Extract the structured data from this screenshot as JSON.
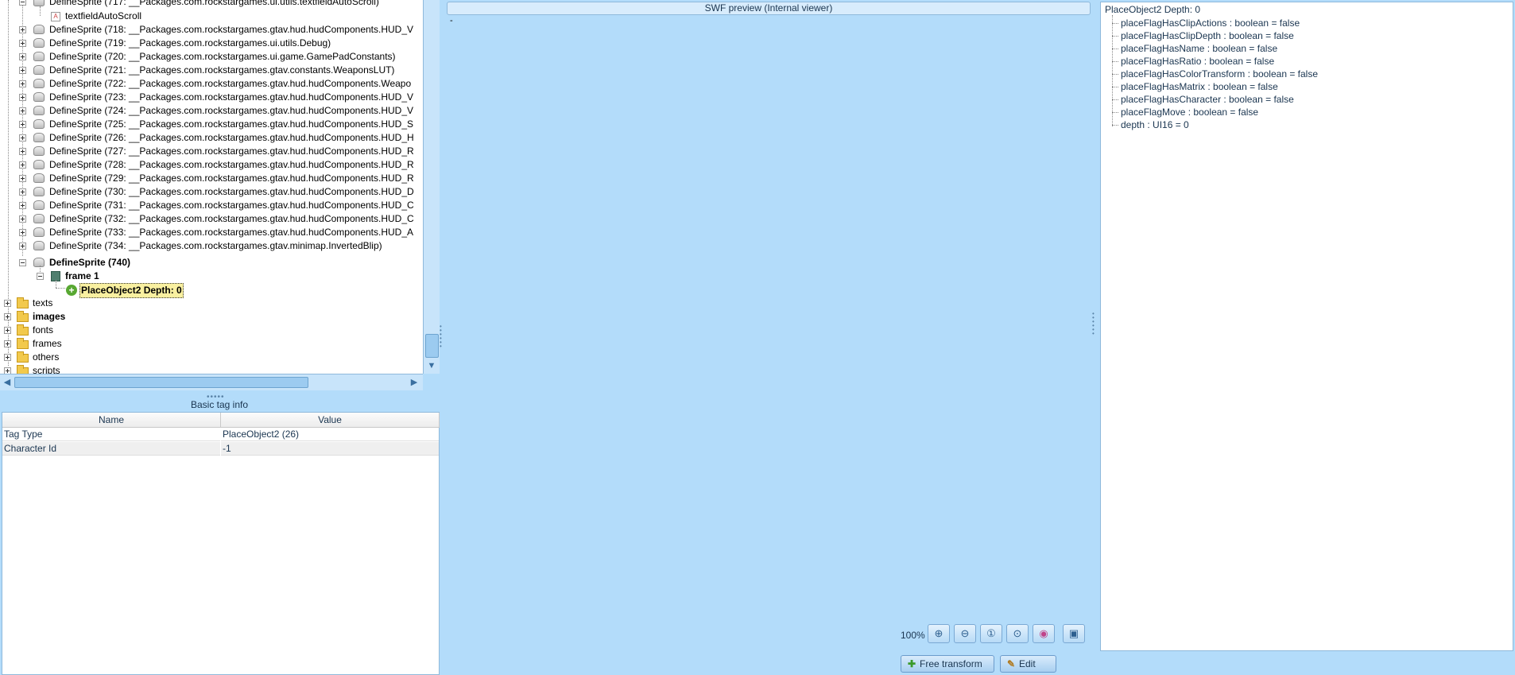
{
  "tree": {
    "top_partial": "DefineSprite (717: __Packages.com.rockstargames.ui.utils.textfieldAutoScroll)",
    "text_child": "textfieldAutoScroll",
    "sprites": [
      "DefineSprite (718: __Packages.com.rockstargames.gtav.hud.hudComponents.HUD_V",
      "DefineSprite (719: __Packages.com.rockstargames.ui.utils.Debug)",
      "DefineSprite (720: __Packages.com.rockstargames.ui.game.GamePadConstants)",
      "DefineSprite (721: __Packages.com.rockstargames.gtav.constants.WeaponsLUT)",
      "DefineSprite (722: __Packages.com.rockstargames.gtav.hud.hudComponents.Weapo",
      "DefineSprite (723: __Packages.com.rockstargames.gtav.hud.hudComponents.HUD_V",
      "DefineSprite (724: __Packages.com.rockstargames.gtav.hud.hudComponents.HUD_V",
      "DefineSprite (725: __Packages.com.rockstargames.gtav.hud.hudComponents.HUD_S",
      "DefineSprite (726: __Packages.com.rockstargames.gtav.hud.hudComponents.HUD_H",
      "DefineSprite (727: __Packages.com.rockstargames.gtav.hud.hudComponents.HUD_R",
      "DefineSprite (728: __Packages.com.rockstargames.gtav.hud.hudComponents.HUD_R",
      "DefineSprite (729: __Packages.com.rockstargames.gtav.hud.hudComponents.HUD_R",
      "DefineSprite (730: __Packages.com.rockstargames.gtav.hud.hudComponents.HUD_D",
      "DefineSprite (731: __Packages.com.rockstargames.gtav.hud.hudComponents.HUD_C",
      "DefineSprite (732: __Packages.com.rockstargames.gtav.hud.hudComponents.HUD_C",
      "DefineSprite (733: __Packages.com.rockstargames.gtav.hud.hudComponents.HUD_A",
      "DefineSprite (734: __Packages.com.rockstargames.gtav.minimap.InvertedBlip)"
    ],
    "open_sprite": "DefineSprite (740)",
    "frame": "frame 1",
    "selected": "PlaceObject2 Depth: 0",
    "folders": [
      "texts",
      "images",
      "fonts",
      "frames",
      "others",
      "scripts"
    ]
  },
  "tag_info": {
    "title": "Basic tag info",
    "columns": [
      "Name",
      "Value"
    ],
    "rows": [
      {
        "name": "Tag Type",
        "value": "PlaceObject2 (26)"
      },
      {
        "name": "Character Id",
        "value": "-1"
      }
    ]
  },
  "preview": {
    "header": "SWF preview (Internal viewer)",
    "placeholder": "-",
    "zoom": "100%",
    "tools": [
      "zoom-in-icon",
      "zoom-out-icon",
      "zoom-reset-icon",
      "zoom-fit-icon",
      "color-picker-icon",
      "snapshot-icon"
    ],
    "free_transform": "Free transform",
    "edit": "Edit"
  },
  "properties": {
    "root": "PlaceObject2 Depth: 0",
    "items": [
      "placeFlagHasClipActions : boolean = false",
      "placeFlagHasClipDepth : boolean = false",
      "placeFlagHasName : boolean = false",
      "placeFlagHasRatio : boolean = false",
      "placeFlagHasColorTransform : boolean = false",
      "placeFlagHasMatrix : boolean = false",
      "placeFlagHasCharacter : boolean = false",
      "placeFlagMove : boolean = false",
      "depth : UI16 = 0"
    ]
  }
}
